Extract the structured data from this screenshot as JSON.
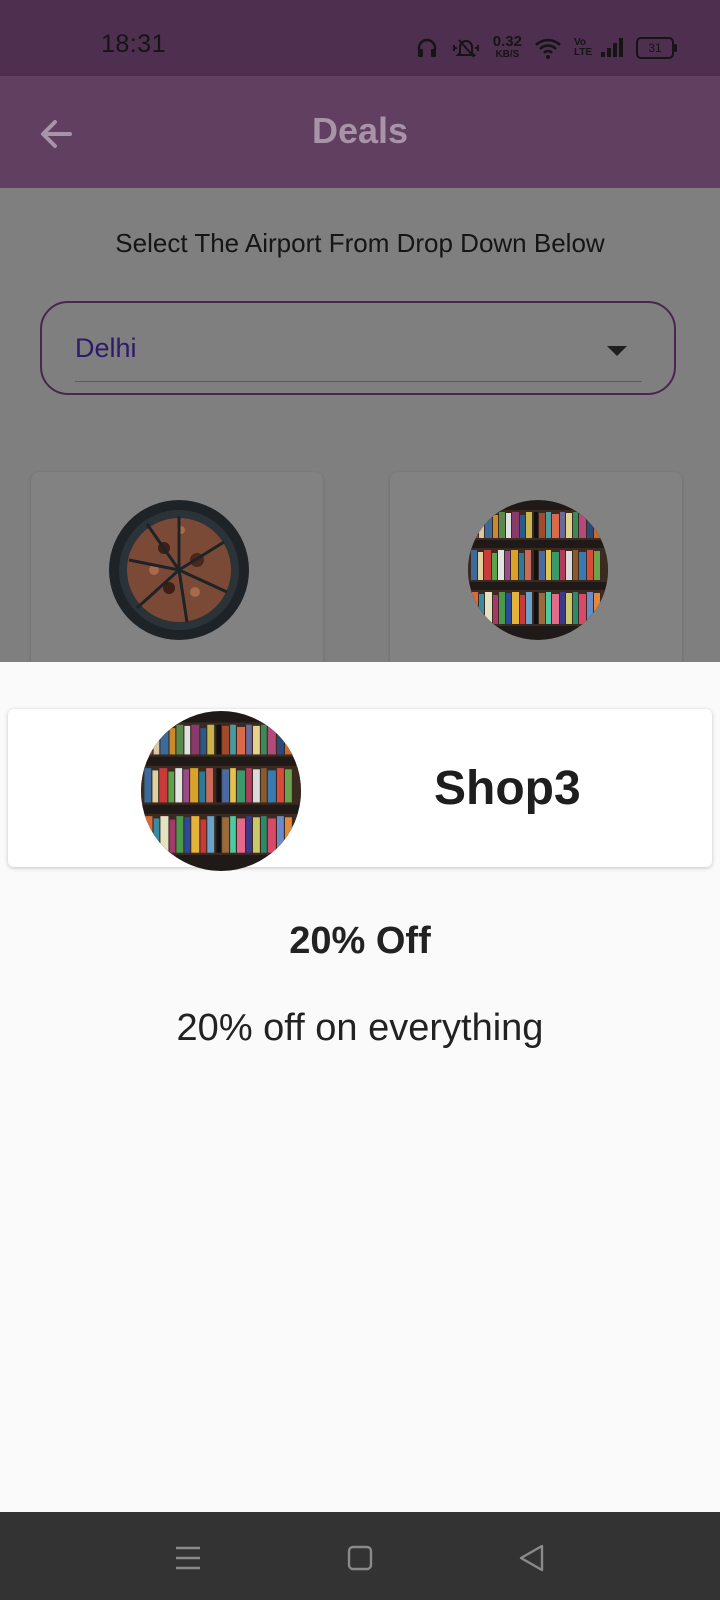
{
  "status_bar": {
    "time": "18:31",
    "net_speed_value": "0.32",
    "net_speed_unit": "KB/S",
    "network_label": "Vo LTE",
    "battery": "31",
    "icons": [
      "headphones-icon",
      "vibrate-icon",
      "wifi-icon",
      "signal-icon",
      "battery-icon"
    ]
  },
  "app_bar": {
    "title": "Deals",
    "back_icon": "arrow-left-icon"
  },
  "page": {
    "prompt": "Select The Airport From Drop Down Below",
    "airport_dropdown": {
      "selected": "Delhi",
      "icon": "dropdown-arrow-icon"
    },
    "shops": [
      {
        "image": "pizza"
      },
      {
        "image": "bookshelf"
      }
    ]
  },
  "sheet": {
    "shop_name": "Shop3",
    "deal_title": "20% Off",
    "deal_description": "20% off on everything"
  },
  "nav_bar": {
    "icons": [
      "menu-icon",
      "home-square-icon",
      "back-triangle-icon"
    ]
  },
  "colors": {
    "status_bar": "#4e2f4f",
    "app_bar": "#603f61",
    "scrim": "#7f7f7f",
    "accent_border": "#4a2550",
    "nav_bar": "#333333"
  }
}
